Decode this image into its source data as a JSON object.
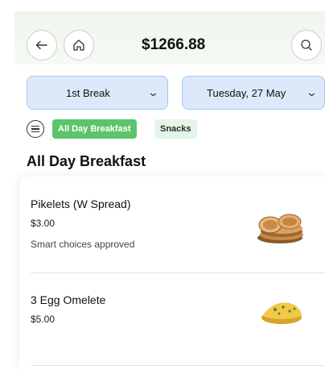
{
  "header": {
    "balance": "$1266.88",
    "back_icon": "arrow-left-icon",
    "home_icon": "home-icon",
    "search_icon": "search-icon"
  },
  "selectors": {
    "break_value": "1st Break",
    "date_value": "Tuesday, 27 May"
  },
  "categories": {
    "active": "All Day Breakfast",
    "other": "Snacks"
  },
  "section": {
    "title": "All Day Breakfast"
  },
  "items": [
    {
      "name": "Pikelets (W Spread)",
      "price": "$3.00",
      "note": "Smart choices approved"
    },
    {
      "name": "3 Egg Omelete",
      "price": "$5.00"
    }
  ],
  "colors": {
    "accent_green": "#5cc46a",
    "select_blue": "#dce9fb"
  }
}
